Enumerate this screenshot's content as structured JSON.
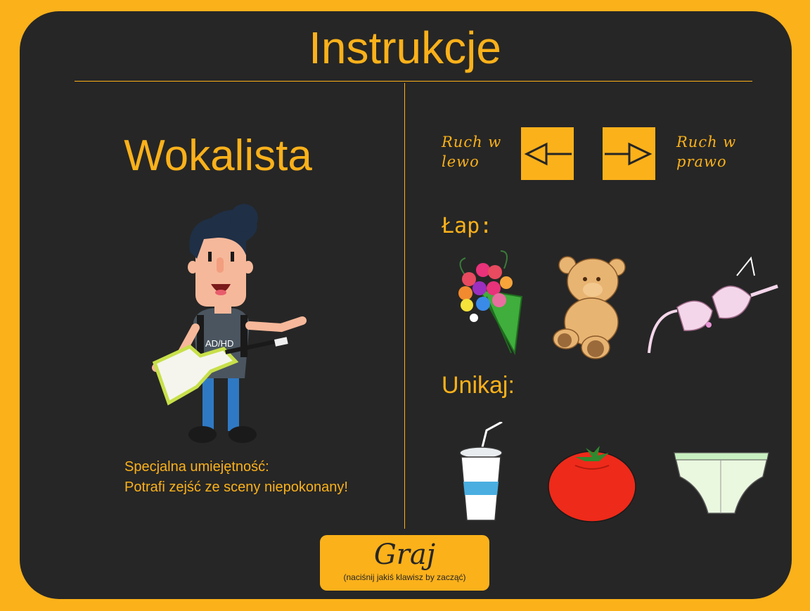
{
  "header": {
    "title": "Instrukcje"
  },
  "character": {
    "name": "Wokalista",
    "shirt_text": "AD/HD",
    "special_line1": "Specjalna umiejętność:",
    "special_line2": "Potrafi zejść ze sceny niepokonany!"
  },
  "controls": {
    "left_line1": "Ruch w",
    "left_line2": "lewo",
    "right_line1": "Ruch w",
    "right_line2": "prawo",
    "left_key_icon": "arrow-left-icon",
    "right_key_icon": "arrow-right-icon"
  },
  "catch": {
    "label": "Łap:",
    "items": [
      "flower-bouquet",
      "teddy-bear",
      "bra"
    ]
  },
  "avoid": {
    "label": "Unikaj:",
    "items": [
      "drink-cup",
      "tomato",
      "underpants"
    ]
  },
  "play": {
    "label": "Graj",
    "hint": "(naciśnij jakiś klawisz by zacząć)"
  },
  "colors": {
    "accent": "#fbb11a",
    "panel": "#262626"
  }
}
